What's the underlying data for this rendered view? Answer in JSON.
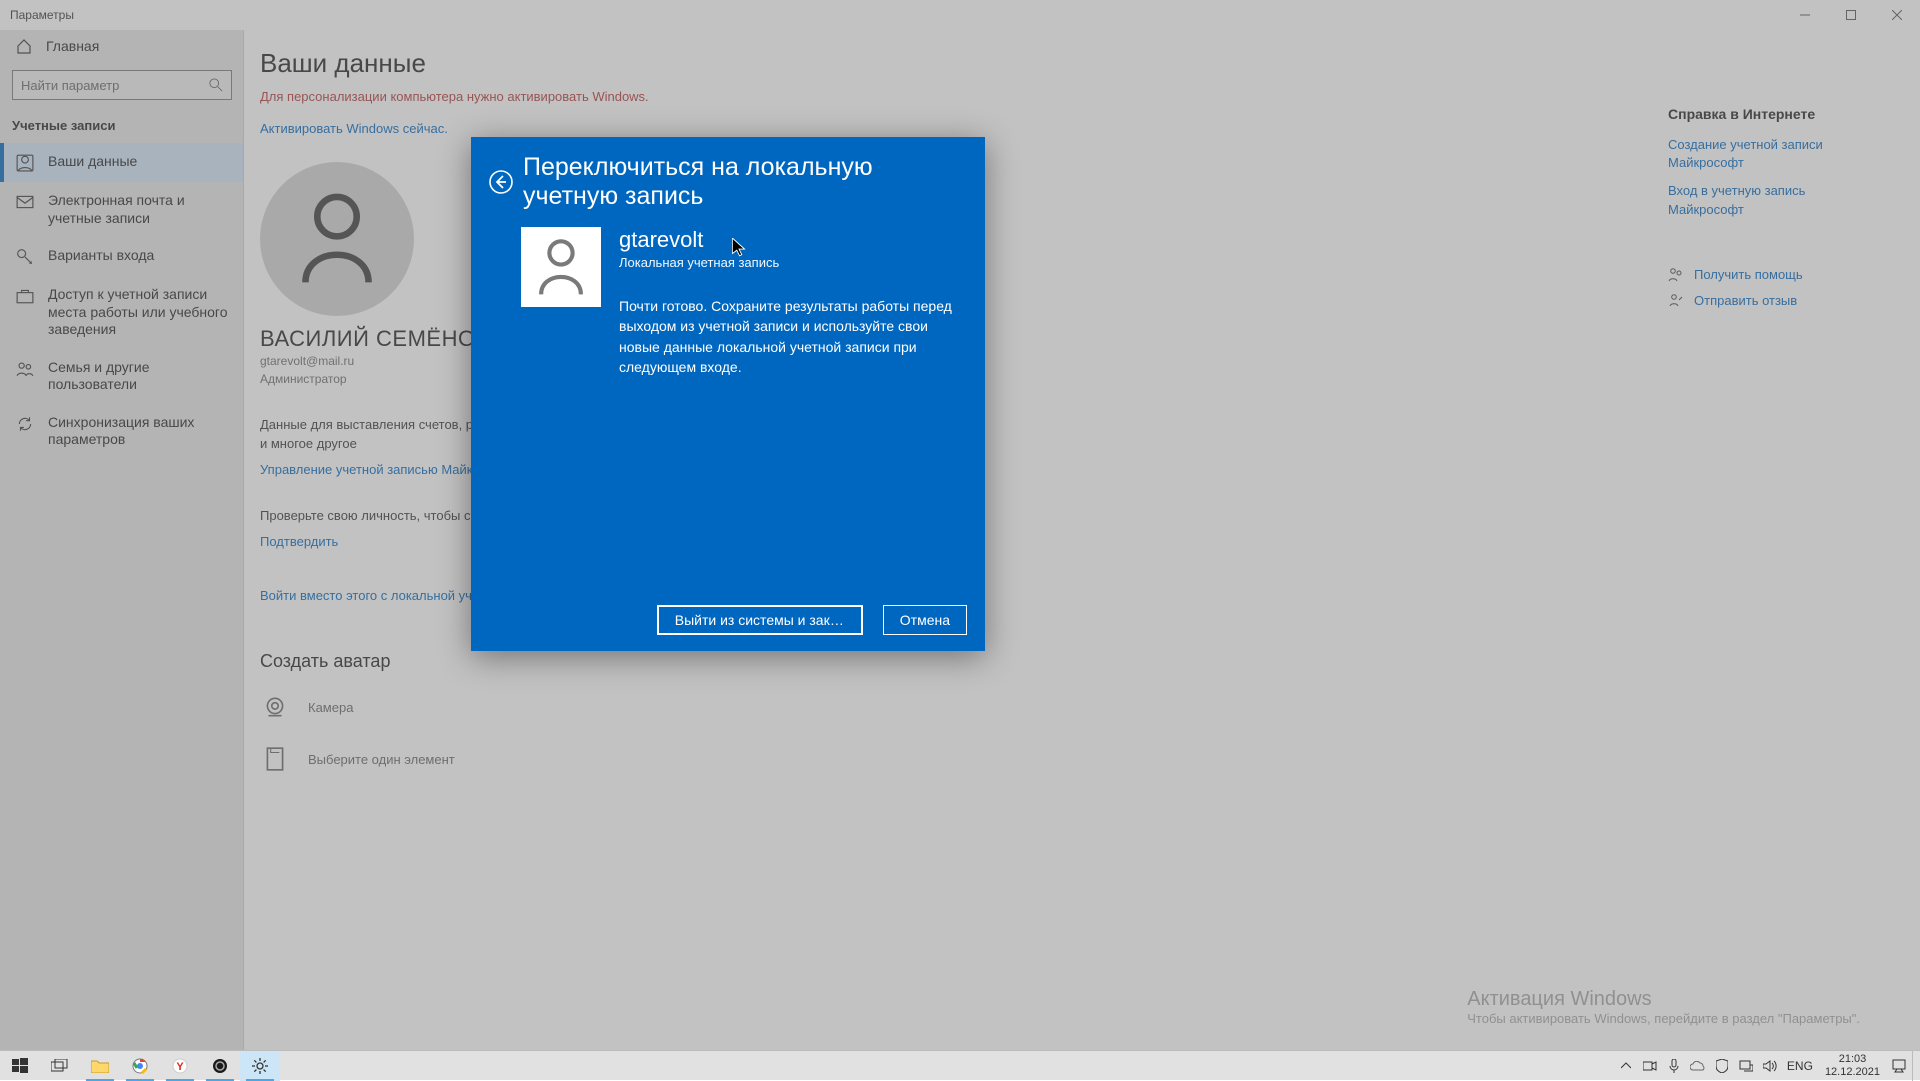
{
  "window_title": "Параметры",
  "sidebar": {
    "home": "Главная",
    "search_placeholder": "Найти параметр",
    "category": "Учетные записи",
    "items": [
      {
        "label": "Ваши данные",
        "icon": "person"
      },
      {
        "label": "Электронная почта и учетные записи",
        "icon": "mail"
      },
      {
        "label": "Варианты входа",
        "icon": "key"
      },
      {
        "label": "Доступ к учетной записи места работы или учебного заведения",
        "icon": "briefcase"
      },
      {
        "label": "Семья и другие пользователи",
        "icon": "people"
      },
      {
        "label": "Синхронизация ваших параметров",
        "icon": "sync"
      }
    ]
  },
  "main": {
    "heading": "Ваши данные",
    "activation_warning": "Для персонализации компьютера нужно активировать Windows.",
    "activate_link": "Активировать Windows сейчас.",
    "profile": {
      "display_name": "ВАСИЛИЙ СЕМЁНОВ",
      "email": "gtarevolt@mail.ru",
      "role": "Администратор"
    },
    "billing_text": "Данные для выставления счетов, родительский контроль, учетные данные, подписки, параметры безопасности и многое другое",
    "manage_link": "Управление учетной записью Майкрософт",
    "verify_text": "Проверьте свою личность, чтобы синхронизировать пароли между различными устройствами.",
    "verify_link": "Подтвердить",
    "local_signin_link": "Войти вместо этого с локальной учетной записью",
    "avatar_section": "Создать аватар",
    "camera": "Камера",
    "choose_one": "Выберите один элемент"
  },
  "right": {
    "help_heading": "Справка в Интернете",
    "links": [
      "Создание учетной записи Майкрософт",
      "Вход в учетную запись Майкрософт"
    ],
    "get_help": "Получить помощь",
    "feedback": "Отправить отзыв"
  },
  "watermark": {
    "line1": "Активация Windows",
    "line2": "Чтобы активировать Windows, перейдите в раздел \"Параметры\"."
  },
  "modal": {
    "title": "Переключиться на локальную учетную запись",
    "username": "gtarevolt",
    "subtitle": "Локальная учетная запись",
    "description": "Почти готово. Сохраните результаты работы перед выходом из учетной записи и используйте свои новые данные локальной учетной записи при следующем входе.",
    "primary": "Выйти из системы и закончить р...",
    "cancel": "Отмена"
  },
  "taskbar": {
    "lang": "ENG",
    "time": "21:03",
    "date": "12.12.2021"
  }
}
